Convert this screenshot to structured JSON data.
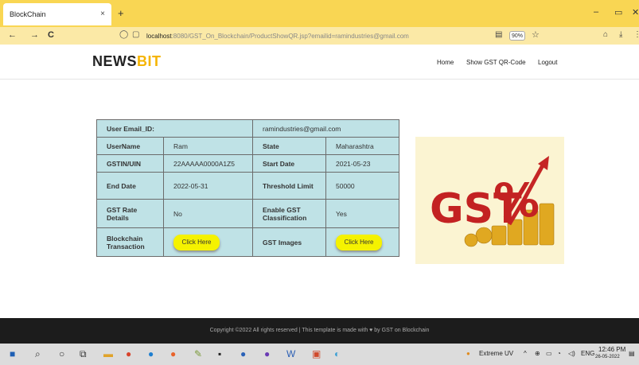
{
  "browser": {
    "tab_title": "BlockChain",
    "tab_close": "×",
    "new_tab": "+",
    "window_controls": {
      "minimize": "–",
      "maximize": "▭",
      "close": "✕"
    },
    "back": "←",
    "forward": "→",
    "reload": "C",
    "url_host": "localhost",
    "url_rest": ":8080/GST_On_Blockchain/ProductShowQR.jsp?emailid=ramindustries@gmail.com",
    "zoom": "90%",
    "bookmark_star": "☆",
    "reader_icon": "▤",
    "pocket_icon": "⌂",
    "download_icon": "⤓",
    "menu_icon": "⋮"
  },
  "site": {
    "logo_main": "NEWS",
    "logo_accent": "BIT",
    "nav": [
      "Home",
      "Show GST QR-Code",
      "Logout"
    ]
  },
  "details": {
    "email_label": "User Email_ID:",
    "email_value": "ramindustries@gmail.com",
    "username_label": "UserName",
    "username_value": "Ram",
    "state_label": "State",
    "state_value": "Maharashtra",
    "gstin_label": "GSTIN/UIN",
    "gstin_value": "22AAAAA0000A1Z5",
    "start_label": "Start Date",
    "start_value": "2021-05-23",
    "end_label": "End Date",
    "end_value": "2022-05-31",
    "threshold_label": "Threshold Limit",
    "threshold_value": "50000",
    "rate_label": "GST Rate Details",
    "rate_value": "No",
    "classification_label": "Enable GST Classification",
    "classification_value": "Yes",
    "blockchain_label": "Blockchain Transaction",
    "blockchain_button": "Click Here",
    "images_label": "GST Images",
    "images_button": "Click Here"
  },
  "gst_image": {
    "text": "GST",
    "percent": "%"
  },
  "footer": {
    "text": "Copyright ©2022 All rights reserved | This template is made with ♥ by GST on Blockchain"
  },
  "taskbar": {
    "weather": "Extreme UV",
    "lang": "ENG",
    "time": "12:46 PM",
    "date": "26-05-2022"
  },
  "colors": {
    "tab_bar": "#f9d653",
    "table_bg": "#bfe2e6",
    "button": "#f5f200",
    "logo_accent": "#f5b400",
    "footer_bg": "#1c1c1c"
  }
}
